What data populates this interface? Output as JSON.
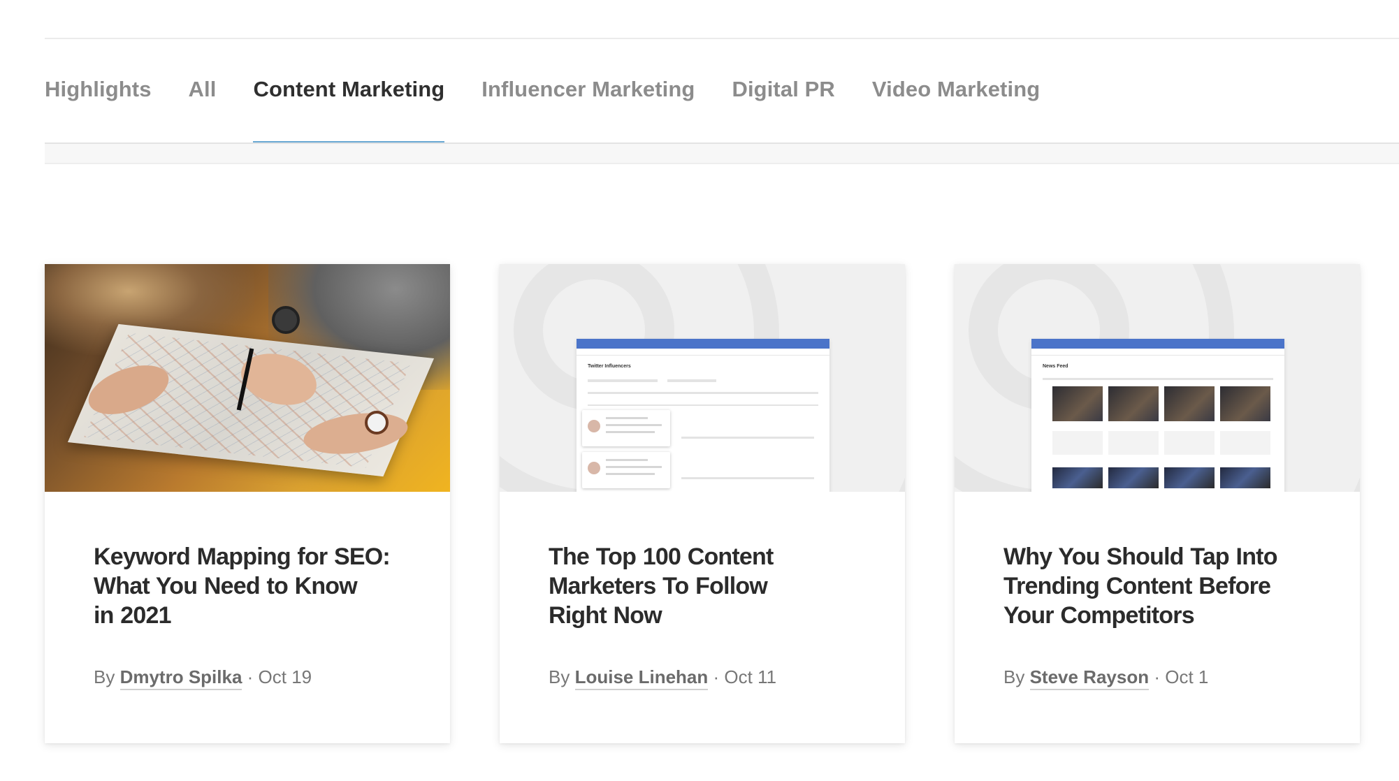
{
  "tabs": [
    {
      "label": "Highlights",
      "active": false
    },
    {
      "label": "All",
      "active": false
    },
    {
      "label": "Content Marketing",
      "active": true
    },
    {
      "label": "Influencer Marketing",
      "active": false
    },
    {
      "label": "Digital PR",
      "active": false
    },
    {
      "label": "Video Marketing",
      "active": false
    }
  ],
  "colors": {
    "active_tab_underline": "#68a8d3",
    "active_tab_text": "#2f2f2f",
    "inactive_tab_text": "#8c8c8c",
    "mock_header": "#4b74c9"
  },
  "articles": [
    {
      "title_lines": [
        "Keyword Mapping for SEO:",
        "What You Need to Know",
        "in 2021"
      ],
      "by": "By",
      "author": "Dmytro Spilka",
      "sep": "·",
      "date": "Oct 19",
      "image": "map-photo"
    },
    {
      "title_lines": [
        "The Top 100 Content",
        "Marketers To Follow",
        "Right Now"
      ],
      "by": "By",
      "author": "Louise Linehan",
      "sep": "·",
      "date": "Oct 11",
      "image": "influencers-screenshot",
      "mock_title": "Twitter Influencers"
    },
    {
      "title_lines": [
        "Why You Should Tap Into",
        "Trending Content Before",
        "Your Competitors"
      ],
      "by": "By",
      "author": "Steve Rayson",
      "sep": "·",
      "date": "Oct 1",
      "image": "news-feed-screenshot",
      "mock_title": "News Feed"
    }
  ]
}
